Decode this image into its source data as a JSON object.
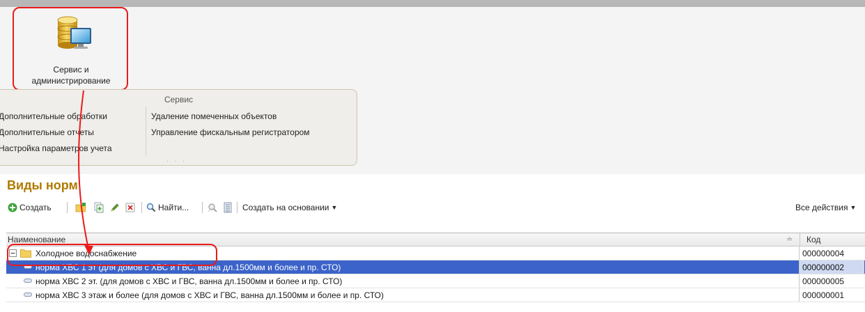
{
  "section": {
    "label_line1": "Сервис и",
    "label_line2": "администрирование",
    "icon": "database-computer-icon"
  },
  "service_panel": {
    "title": "Сервис",
    "left_items": [
      "Дополнительные обработки",
      "Дополнительные отчеты",
      "Настройка параметров учета"
    ],
    "right_items": [
      "Удаление помеченных объектов",
      "Управление фискальным регистратором"
    ],
    "more": "· · ·"
  },
  "page": {
    "title": "Виды норм"
  },
  "toolbar": {
    "create": "Создать",
    "find": "Найти...",
    "create_based_on": "Создать на основании",
    "all_actions": "Все действия"
  },
  "table": {
    "headers": {
      "name": "Наименование",
      "code": "Код"
    },
    "rows": [
      {
        "name": "Холодное водоснабжение",
        "code": "000000004",
        "type": "group",
        "expanded": true
      },
      {
        "name": "норма ХВС 1 эт (для домов с ХВС и ГВС, ванна дл.1500мм и более и пр. СТО)",
        "code": "000000002",
        "type": "item",
        "selected": true
      },
      {
        "name": "норма ХВС 2 эт. (для домов с ХВС и ГВС, ванна дл.1500мм и более и пр. СТО)",
        "code": "000000005",
        "type": "item"
      },
      {
        "name": "норма ХВС 3 этаж и более (для домов с ХВС и ГВС, ванна дл.1500мм и более и пр. СТО)",
        "code": "000000001",
        "type": "item"
      }
    ]
  },
  "colors": {
    "title": "#b07a00",
    "selection": "#3b63c9",
    "highlight": "#ea1a1a"
  }
}
